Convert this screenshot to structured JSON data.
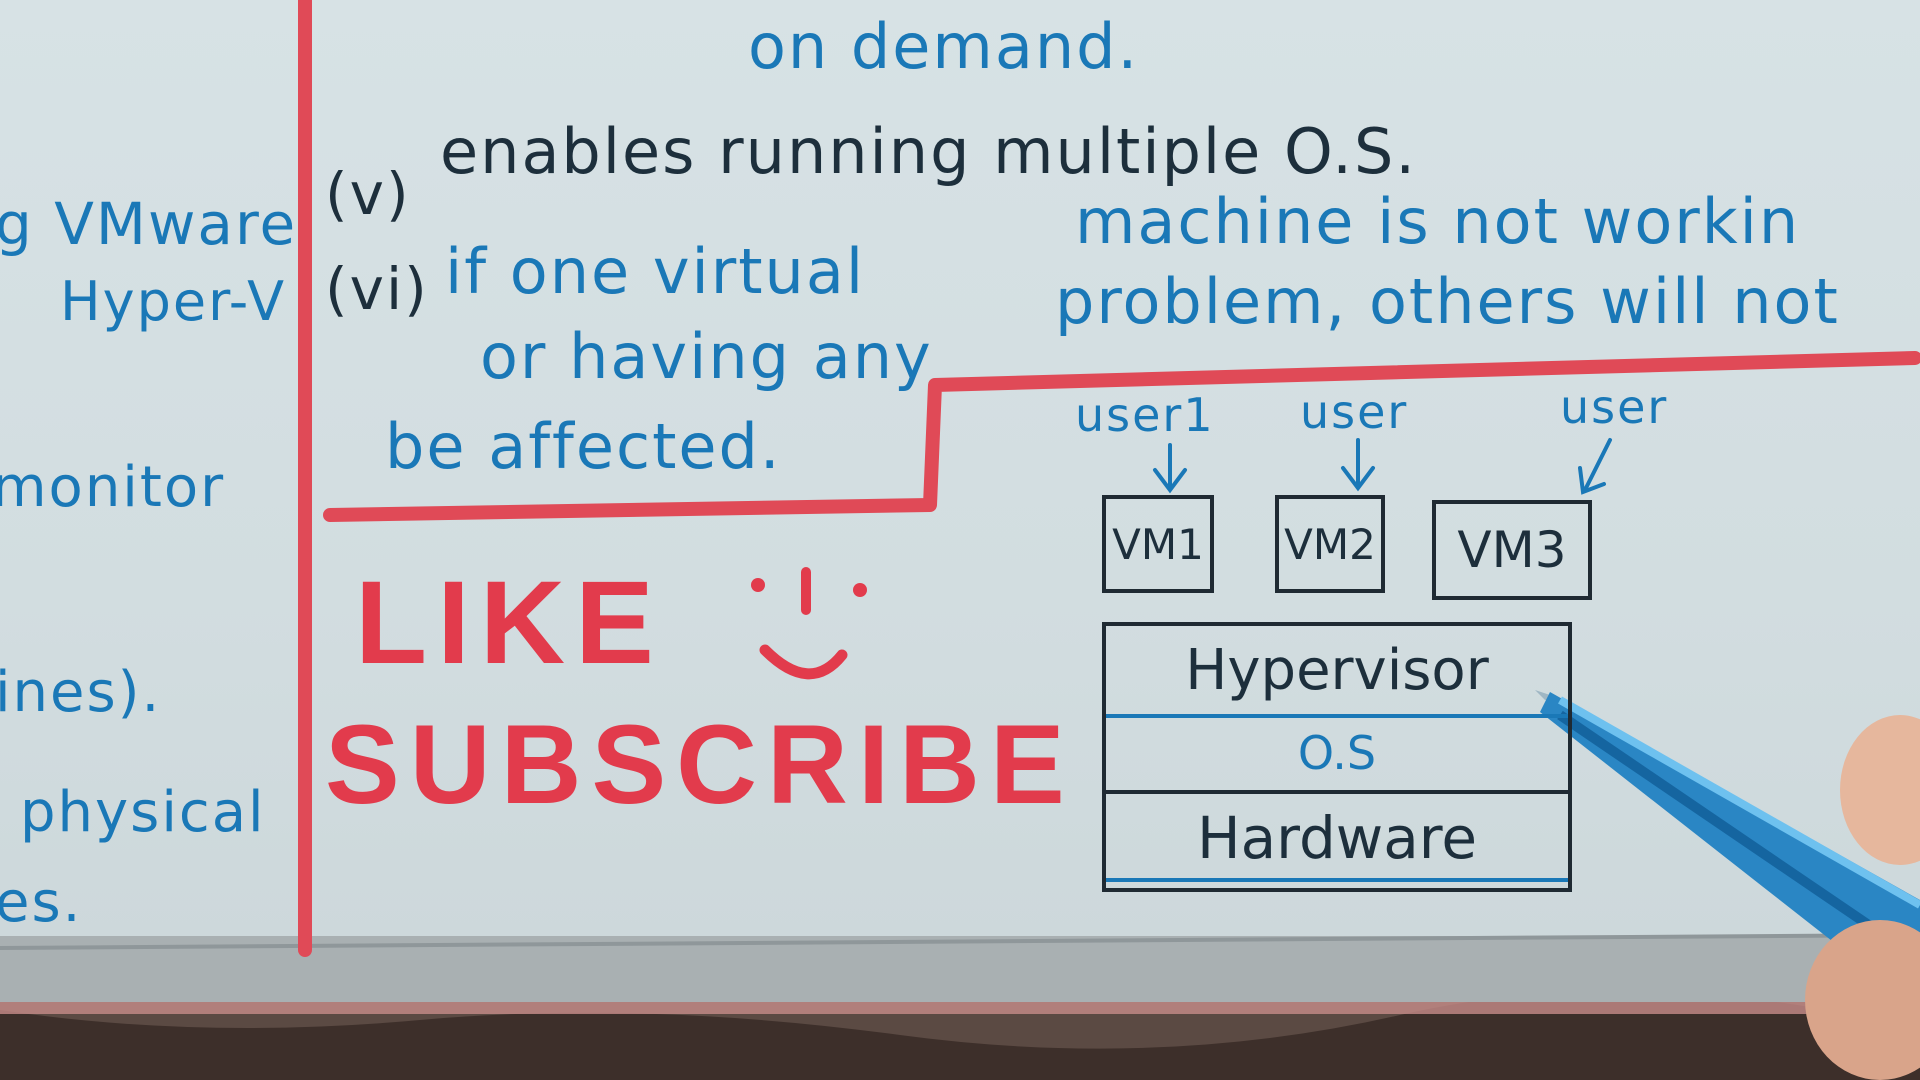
{
  "board": {
    "left_column": {
      "line1": "g VMware",
      "line2": "Hyper-V",
      "line3": "monitor",
      "line4": "ines).",
      "line5": "physical",
      "line6": "es."
    },
    "points": {
      "on_demand": "on demand.",
      "point_v_number": "(v)",
      "point_v_text": "enables running multiple O.S.",
      "point_vi_number": "(vi)",
      "point_vi_line1_a": "if one virtual",
      "point_vi_line1_b": "machine is not workin",
      "point_vi_line2_a": "or having any",
      "point_vi_line2_b": "problem, others will not",
      "point_vi_line3": "be affected."
    },
    "promo": {
      "like": "LIKE",
      "subscribe": "SUBSCRIBE"
    },
    "diagram": {
      "users": [
        "user1",
        "user",
        "user"
      ],
      "vms": [
        "VM1",
        "VM2",
        "VM3"
      ],
      "layers": [
        "Hypervisor",
        "O.S",
        "Hardware"
      ]
    }
  }
}
